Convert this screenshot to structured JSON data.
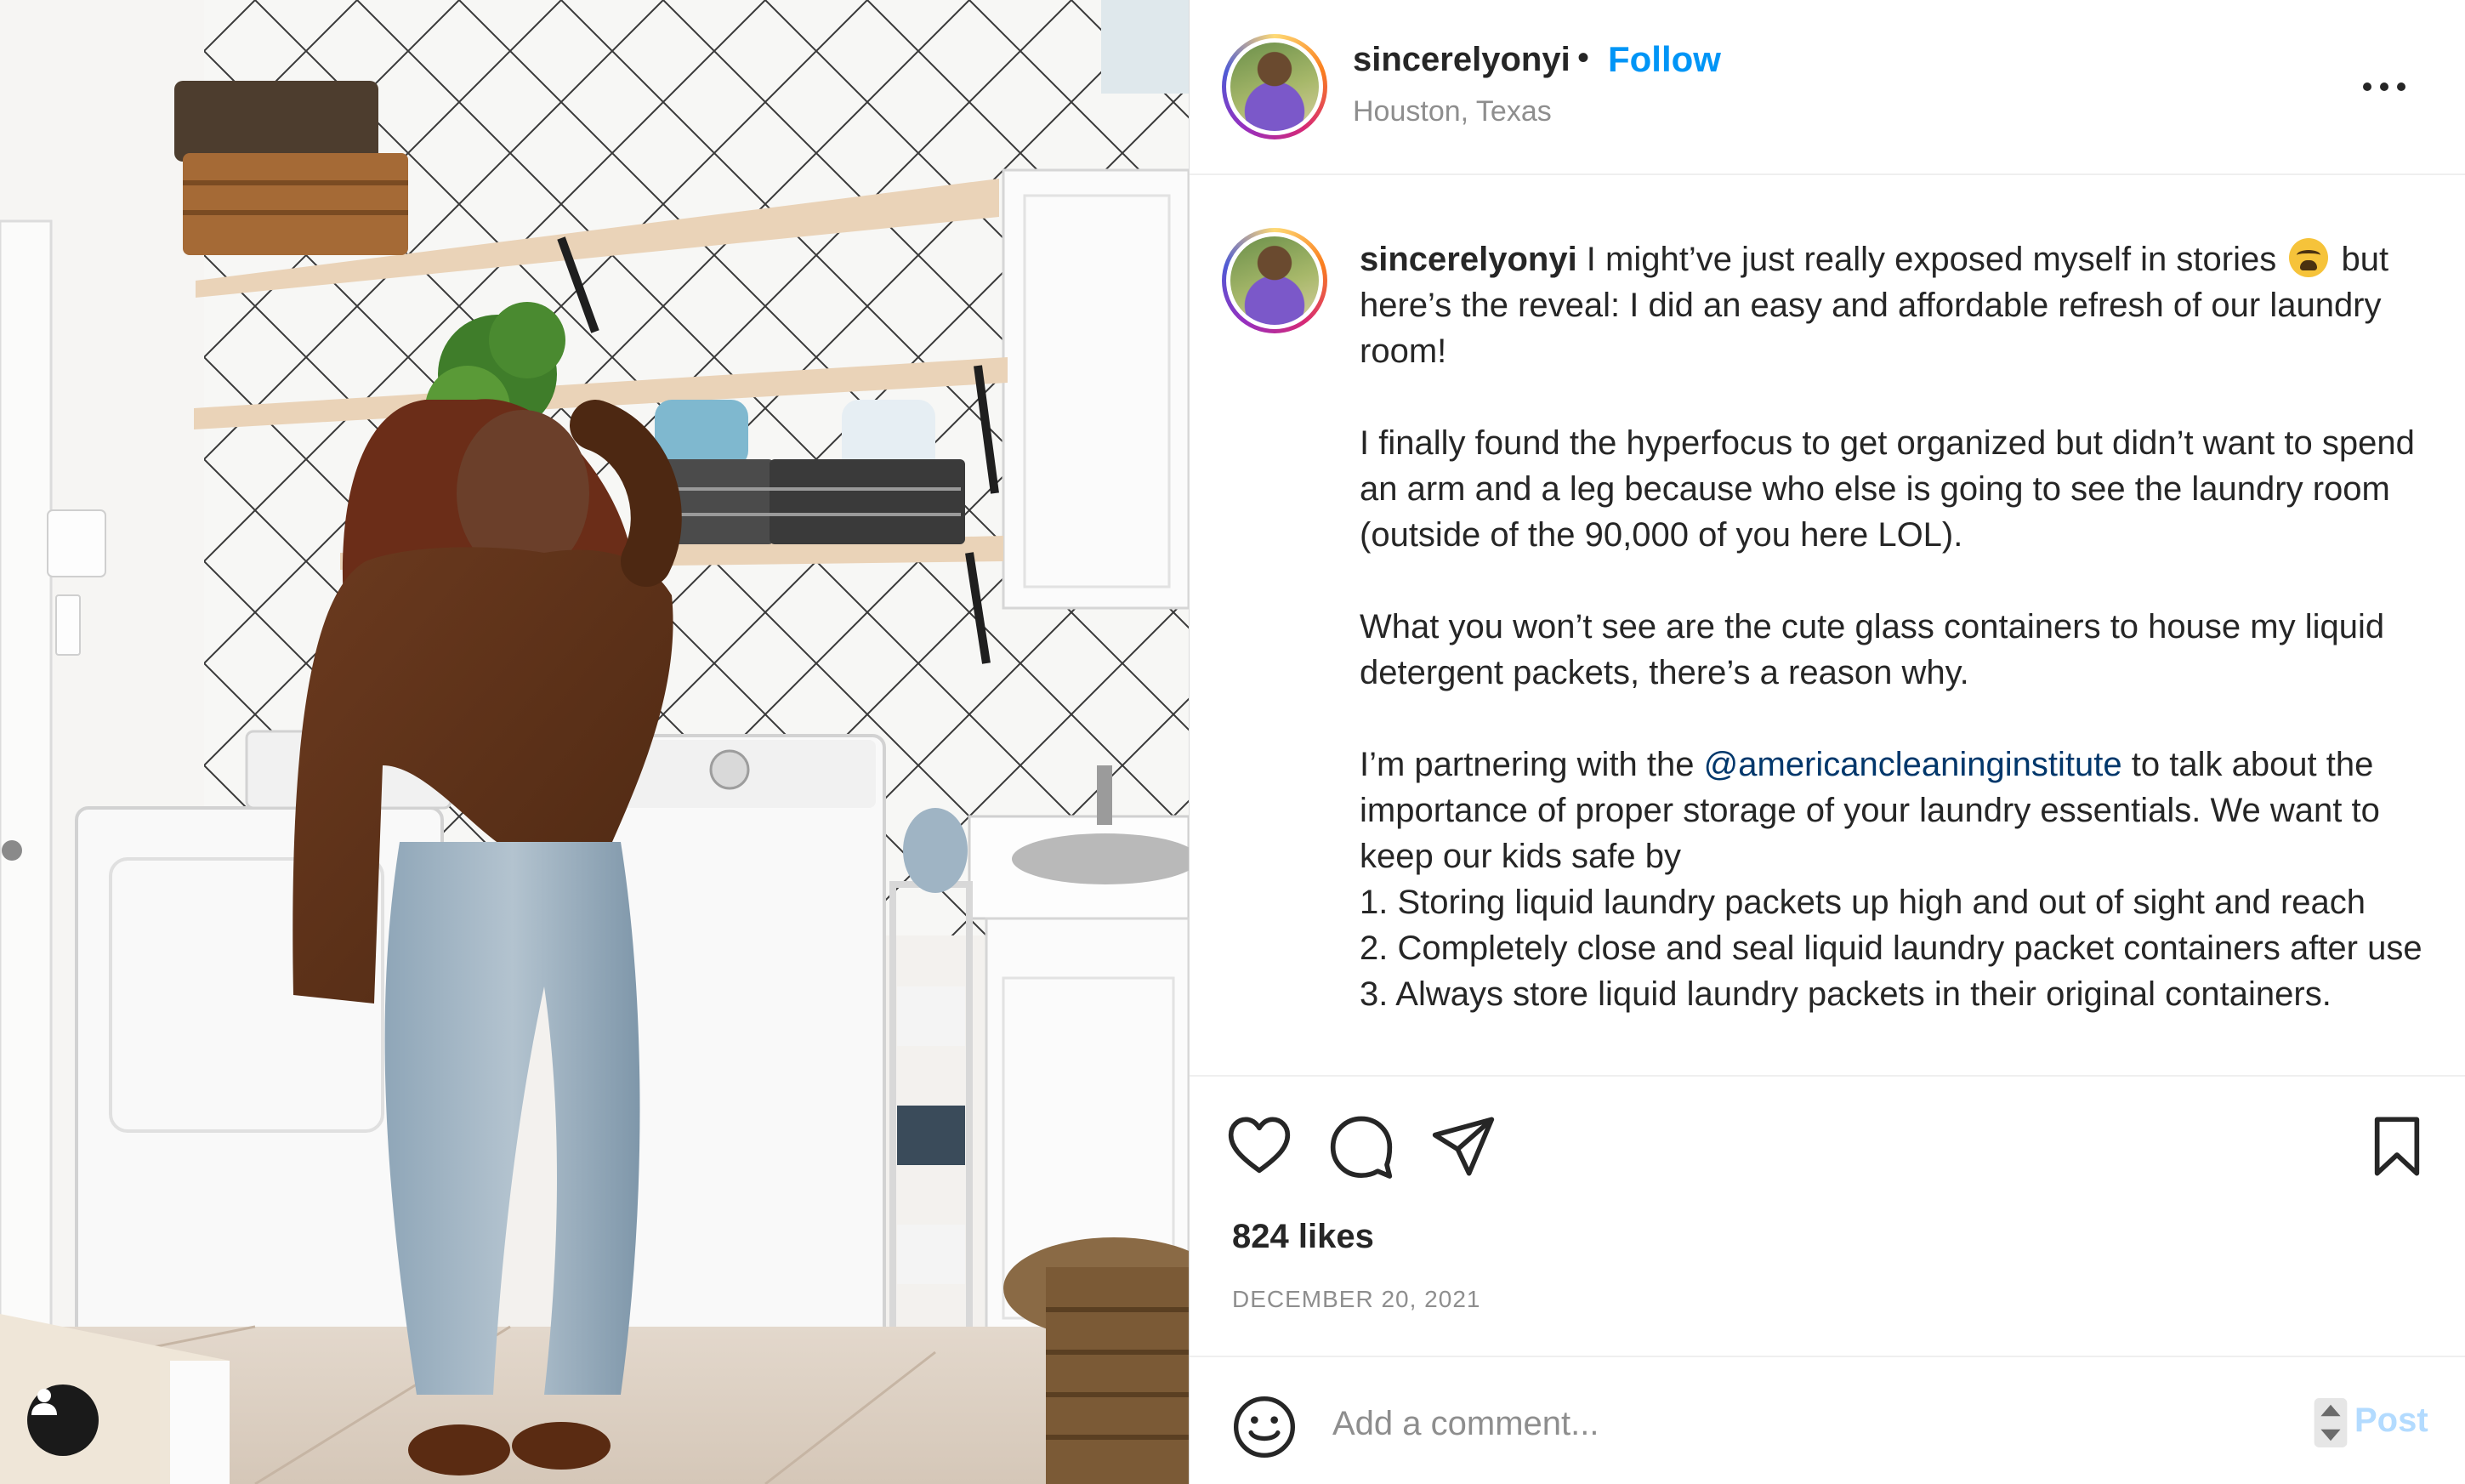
{
  "post": {
    "username": "sincerelyonyi",
    "separator": "•",
    "follow_label": "Follow",
    "location": "Houston, Texas"
  },
  "caption": {
    "username": "sincerelyonyi",
    "text_part1": " I might’ve just really exposed myself in stories ",
    "text_part2": " but here’s the reveal: I did an easy and affordable refresh of our laundry room!\n\nI finally found the hyperfocus to get organized but didn’t want to spend an arm and a leg because who else is going to see the laundry room (outside of the 90,000 of you here LOL).\n\nWhat you won’t see are the cute glass containers to house my liquid detergent packets, there’s a reason why.\n\nI’m partnering with the ",
    "mention": "@americancleaninginstitute",
    "text_part3": " to talk about the importance of proper storage of your laundry essentials. We want to keep our kids safe by\n1. Storing liquid laundry packets up high and out of sight and reach\n2. Completely close and seal liquid laundry packet containers after use\n3. Always store liquid laundry packets in their original containers.",
    "emoji_name": "weary-face-emoji"
  },
  "stats": {
    "likes": "824 likes",
    "date": "DECEMBER 20, 2021"
  },
  "comment": {
    "placeholder": "Add a comment...",
    "post_label": "Post"
  },
  "icons": {
    "like": "heart-icon",
    "comment": "comment-icon",
    "share": "send-icon",
    "save": "bookmark-icon",
    "emoji": "smiley-icon",
    "tagged_users": "user-icon",
    "more": "more-options-icon"
  },
  "colors": {
    "follow": "#0095f6",
    "mention": "#00376b",
    "post_disabled": "#b3dbff",
    "secondary_text": "#8e8e8e"
  }
}
